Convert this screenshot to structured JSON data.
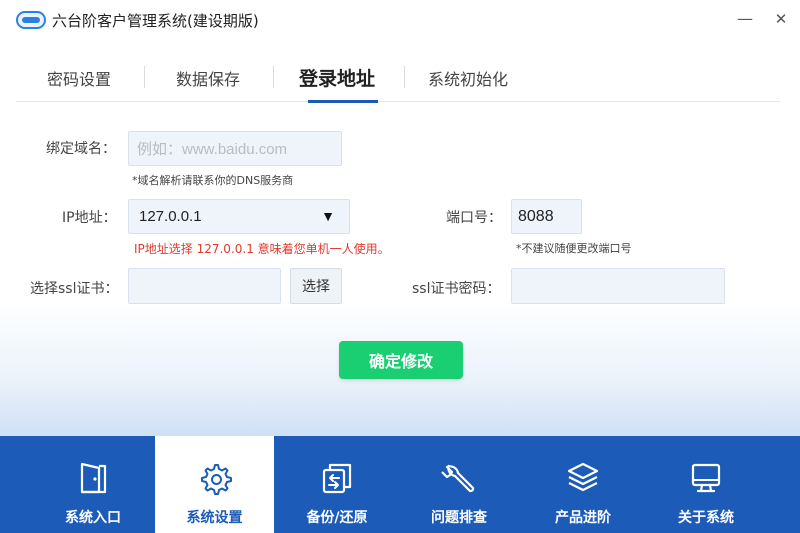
{
  "app": {
    "title": "六台阶客户管理系统(建设期版)",
    "minimize": "—",
    "close": "✕"
  },
  "tabs": [
    {
      "label": "密码设置"
    },
    {
      "label": "数据保存"
    },
    {
      "label": "登录地址",
      "active": true
    },
    {
      "label": "系统初始化"
    }
  ],
  "form": {
    "domain_label": "绑定域名：",
    "domain_placeholder": "例如：www.baidu.com",
    "domain_hint": "*域名解析请联系你的DNS服务商",
    "ip_label": "IP地址：",
    "ip_value": "127.0.0.1",
    "ip_arrow": "▼",
    "ip_hint": "IP地址选择 127.0.0.1 意味着您单机一人使用。",
    "port_label": "端口号：",
    "port_value": "8088",
    "port_hint": "*不建议随便更改端口号",
    "ssl_label": "选择ssl证书：",
    "ssl_value": "",
    "choose_button": "选择",
    "ssl_password_label": "ssl证书密码：",
    "ssl_password_value": "",
    "confirm_button": "确定修改"
  },
  "bottom_nav": [
    {
      "label": "系统入口",
      "icon": "door-icon"
    },
    {
      "label": "系统设置",
      "icon": "gear-icon",
      "active": true
    },
    {
      "label": "备份/还原",
      "icon": "backup-icon"
    },
    {
      "label": "问题排查",
      "icon": "wrench-icon"
    },
    {
      "label": "产品进阶",
      "icon": "layers-icon"
    },
    {
      "label": "关于系统",
      "icon": "monitor-icon"
    }
  ],
  "colors": {
    "brand_blue": "#1c5cb8",
    "confirm_green": "#19cf72",
    "warning_red": "#e03a2e"
  }
}
